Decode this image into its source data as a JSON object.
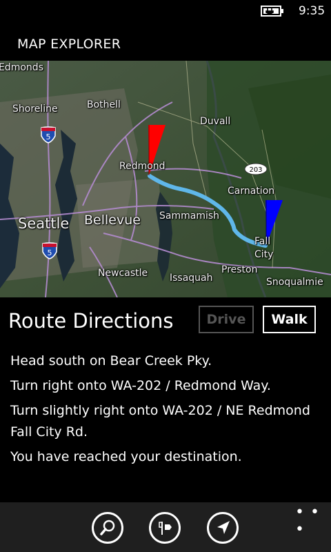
{
  "status": {
    "time": "9:35",
    "battery_icon": "battery-charging-icon"
  },
  "app": {
    "title": "MAP EXPLORER"
  },
  "map": {
    "labels": {
      "edmonds": "Edmonds",
      "shoreline": "Shoreline",
      "bothell": "Bothell",
      "duvall": "Duvall",
      "redmond": "Redmond",
      "carnation": "Carnation",
      "seattle": "Seattle",
      "bellevue": "Bellevue",
      "sammamish": "Sammamish",
      "fall": "Fall",
      "city": "City",
      "newcastle": "Newcastle",
      "issaquah": "Issaquah",
      "preston": "Preston",
      "snoqualmie": "Snoqualmie"
    },
    "shields": {
      "i5_top": "5",
      "i5_bottom": "5",
      "route203": "203"
    },
    "pins": {
      "start_color": "#ff0000",
      "end_color": "#0000ff"
    },
    "route_color": "#5fb7ea"
  },
  "directions": {
    "title": "Route Directions",
    "drive_label": "Drive",
    "walk_label": "Walk",
    "steps": [
      "Head south on Bear Creek Pky.",
      "Turn right onto WA-202 / Redmond Way.",
      "Turn slightly right onto WA-202 / NE Redmond Fall City Rd.",
      "You have reached your destination."
    ]
  },
  "appbar": {
    "more_label": "• • •",
    "icons": [
      "search-icon",
      "directions-icon",
      "locate-me-icon"
    ]
  }
}
